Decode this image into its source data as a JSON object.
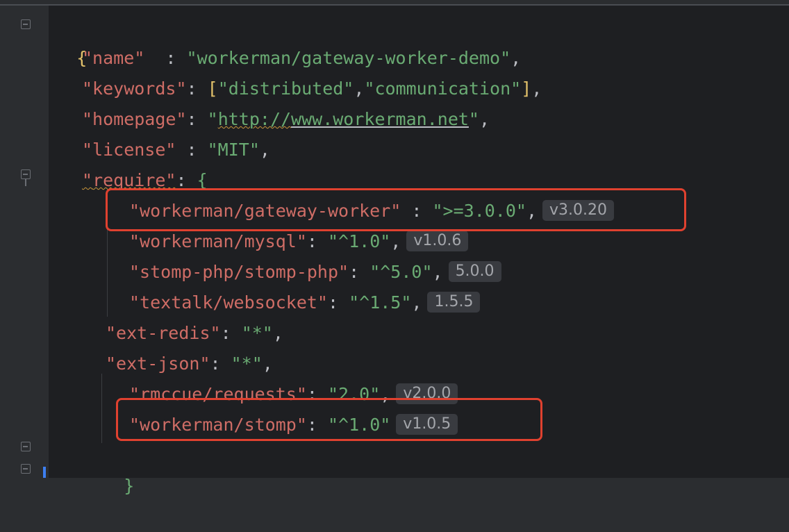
{
  "lines": [
    {
      "text_open": "{"
    },
    {
      "key": "\"name\"",
      "pad": "  ",
      "sep": ": ",
      "value": "\"workerman/gateway-worker-demo\"",
      "end": ","
    },
    {
      "key": "\"keywords\"",
      "sep": ": ",
      "arr_open": "[",
      "v1": "\"distributed\"",
      "comma": ",",
      "v2": "\"communication\"",
      "arr_close": "]",
      "end": ","
    },
    {
      "key": "\"homepage\"",
      "sep": ": ",
      "url_quote_open": "\"",
      "url_scheme": "http://",
      "url_host": "www.workerman.net",
      "url_quote_close": "\"",
      "end": ","
    },
    {
      "key": "\"license\"",
      "sep": " : ",
      "value": "\"MIT\"",
      "end": ","
    },
    {
      "key_q1": "\"",
      "key_word": "require",
      "key_q2": "\"",
      "sep": ": ",
      "brace": "{"
    },
    {
      "key": "\"workerman/gateway-worker\"",
      "sep": " : ",
      "value": "\">=3.0.0\"",
      "end": ",",
      "hint": "v3.0.20"
    },
    {
      "key": "\"workerman/mysql\"",
      "sep": ": ",
      "value": "\"^1.0\"",
      "end": ",",
      "hint": "v1.0.6"
    },
    {
      "key": "\"stomp-php/stomp-php\"",
      "sep": ": ",
      "value": "\"^5.0\"",
      "end": ",",
      "hint": "5.0.0"
    },
    {
      "key": "\"textalk/websocket\"",
      "sep": ": ",
      "value": "\"^1.5\"",
      "end": ",",
      "hint": "1.5.5"
    },
    {
      "key": "\"ext-redis\"",
      "sep": ": ",
      "value": "\"*\"",
      "end": ","
    },
    {
      "key": "\"ext-json\"",
      "sep": ": ",
      "value": "\"*\"",
      "end": ","
    },
    {
      "key": "\"rmccue/requests\"",
      "sep": ": ",
      "value": "\"2.0\"",
      "end": ",",
      "hint": "v2.0.0"
    },
    {
      "key": "\"workerman/stomp\"",
      "sep": ": ",
      "value": "\"^1.0\"",
      "hint": "v1.0.5"
    },
    {
      "close": "}"
    }
  ],
  "colors": {
    "key": "#cf6d66",
    "string": "#6aab73",
    "punct": "#bcbec4",
    "highlight_box": "#e0412f",
    "background": "#1e1f22"
  },
  "icons": [
    "fold-icon",
    "fold-end-icon"
  ]
}
